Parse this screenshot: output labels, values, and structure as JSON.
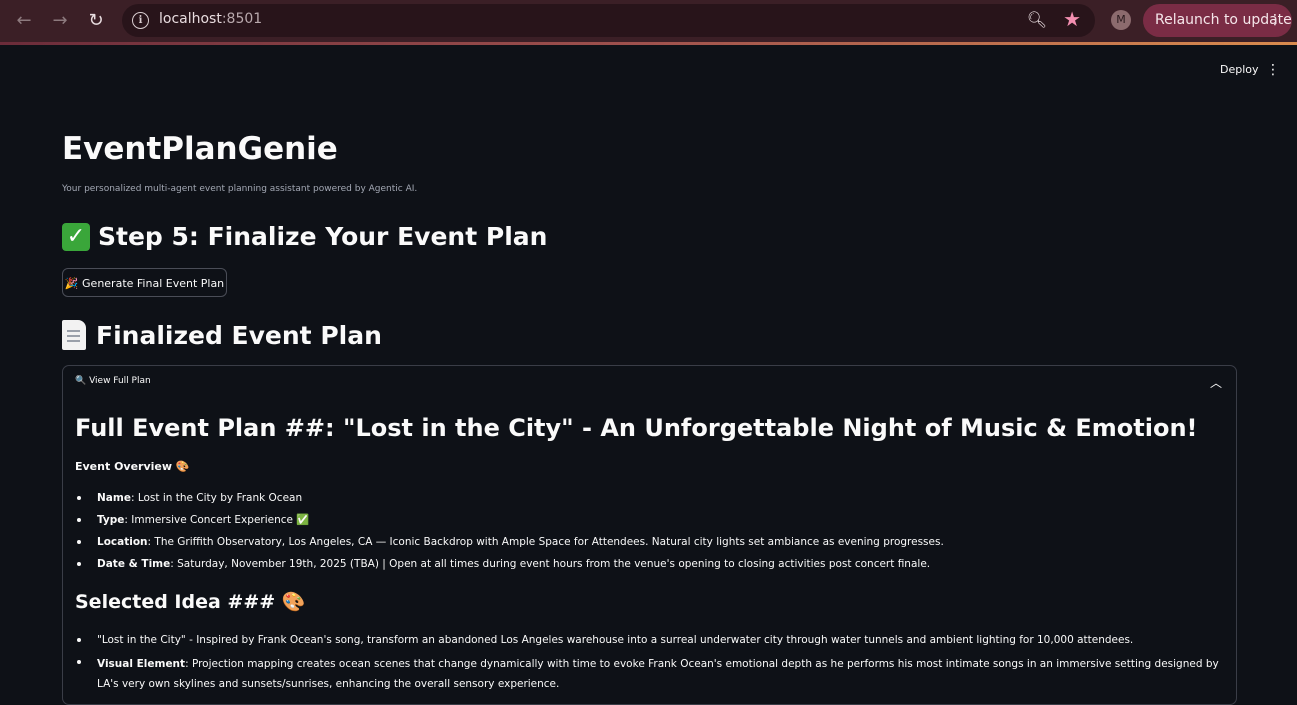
{
  "browser": {
    "url_host": "localhost",
    "url_port": ":8501",
    "profile_initial": "M",
    "relaunch_label": "Relaunch to update"
  },
  "header": {
    "deploy_label": "Deploy"
  },
  "app": {
    "title": "EventPlanGenie",
    "subtitle": "Your personalized multi-agent event planning assistant powered by Agentic AI.",
    "step_heading": "Step 5: Finalize Your Event Plan",
    "generate_button": "🎉 Generate Final Event Plan",
    "finalized_heading": "Finalized Event Plan"
  },
  "expander": {
    "label": "🔍 View Full Plan",
    "plan_title": "Full Event Plan ##: \"Lost in the City\" - An Unforgettable Night of Music & Emotion!",
    "overview_label": "Event Overview 🎨",
    "overview_items": [
      {
        "key": "Name",
        "value": ": Lost in the City by Frank Ocean"
      },
      {
        "key": "Type",
        "value": ": Immersive Concert Experience ✅"
      },
      {
        "key": "Location",
        "value": ": The Griffith Observatory, Los Angeles, CA — Iconic Backdrop with Ample Space for Attendees. Natural city lights set ambiance as evening progresses."
      },
      {
        "key": "Date & Time",
        "value": ": Saturday, November 19th, 2025 (TBA) | Open at all times during event hours from the venue's opening to closing activities post concert finale."
      }
    ],
    "idea_heading": "Selected Idea ### 🎨",
    "idea_items": [
      {
        "key": "",
        "value": "\"Lost in the City\" - Inspired by Frank Ocean's song, transform an abandoned Los Angeles warehouse into a surreal underwater city through water tunnels and ambient lighting for 10,000 attendees."
      },
      {
        "key": "Visual Element",
        "value": ": Projection mapping creates ocean scenes that change dynamically with time to evoke Frank Ocean's emotional depth as he performs his most intimate songs in an immersive setting designed by LA's very own skylines and sunsets/sunrises, enhancing the overall sensory experience."
      }
    ]
  }
}
